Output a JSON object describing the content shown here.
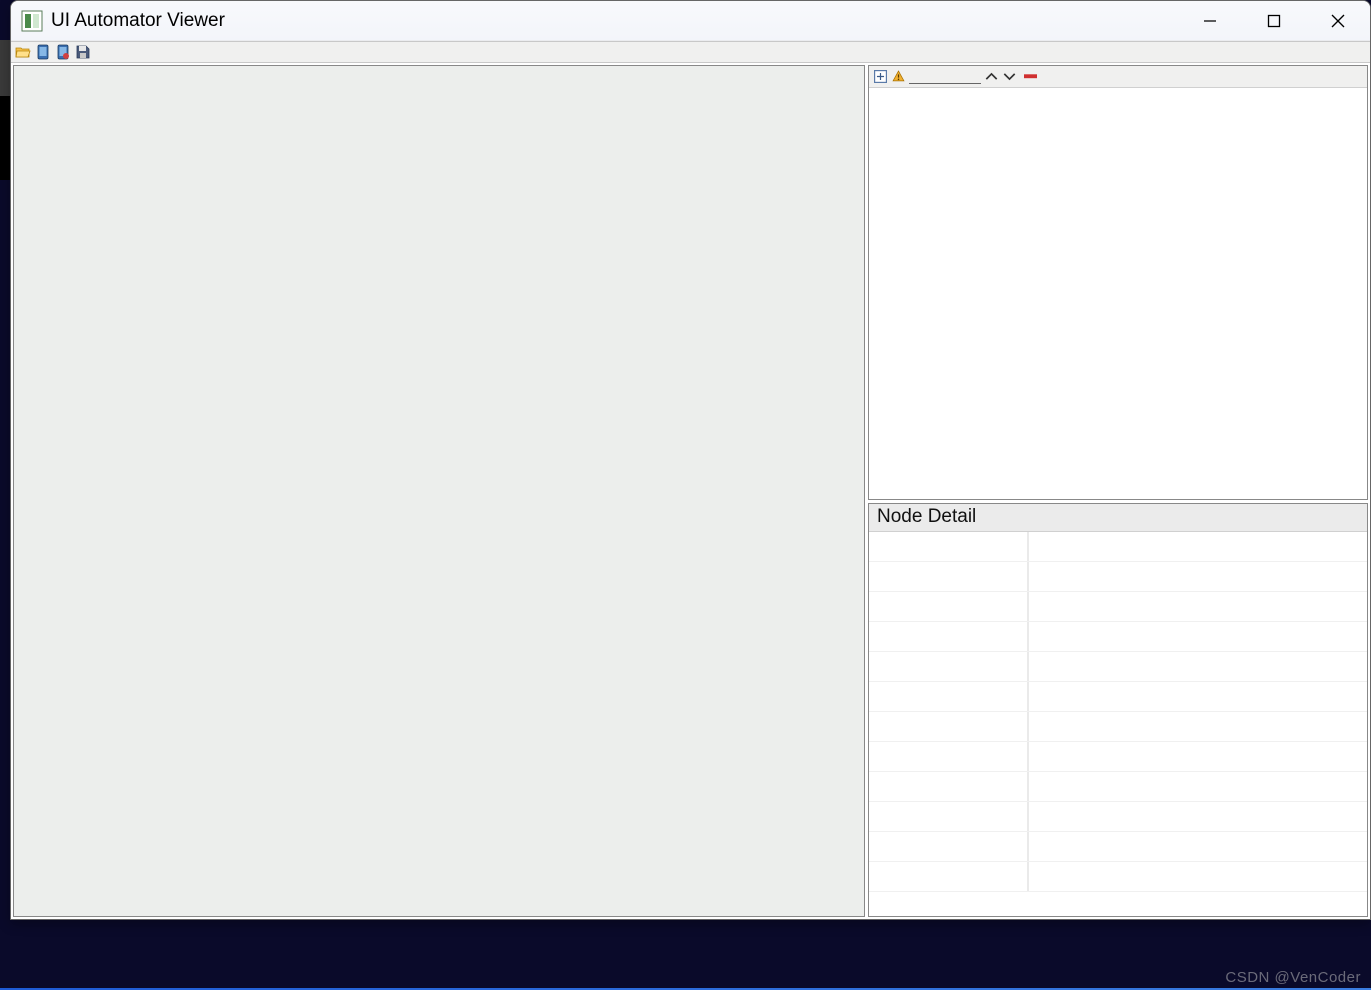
{
  "window": {
    "title": "UI Automator Viewer"
  },
  "toolbar": {
    "open_tooltip": "Open",
    "device_screenshot_tooltip": "Device Screenshot (uiautomator dump)",
    "device_screenshot_compressed_tooltip": "Device Screenshot with Compressed Hierarchy",
    "save_tooltip": "Save"
  },
  "tree": {
    "expand_all_tooltip": "Expand All",
    "toggle_naf_tooltip": "Toggle NAF Nodes",
    "search_value": "",
    "search_prev_tooltip": "Previous",
    "search_next_tooltip": "Next",
    "clear_search_tooltip": "Clear"
  },
  "detail": {
    "header": "Node Detail",
    "rows": [
      {
        "key": "",
        "value": ""
      },
      {
        "key": "",
        "value": ""
      },
      {
        "key": "",
        "value": ""
      },
      {
        "key": "",
        "value": ""
      },
      {
        "key": "",
        "value": ""
      },
      {
        "key": "",
        "value": ""
      },
      {
        "key": "",
        "value": ""
      },
      {
        "key": "",
        "value": ""
      },
      {
        "key": "",
        "value": ""
      },
      {
        "key": "",
        "value": ""
      },
      {
        "key": "",
        "value": ""
      },
      {
        "key": "",
        "value": ""
      }
    ]
  },
  "watermark": "CSDN @VenCoder"
}
